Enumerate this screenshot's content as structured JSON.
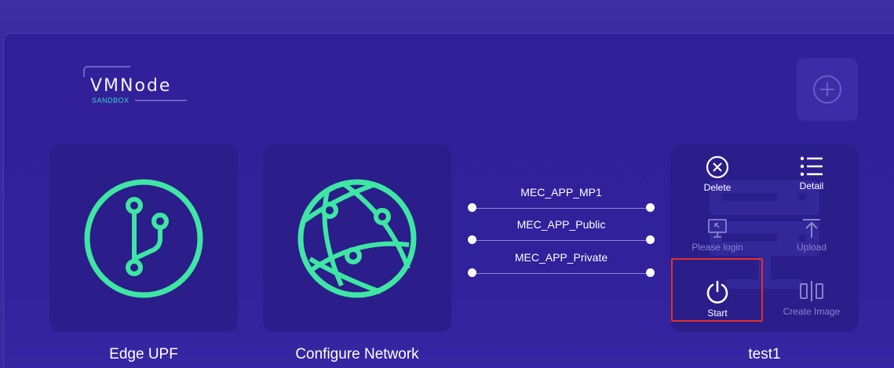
{
  "logo": {
    "title": "VMNode",
    "subtitle": "SANDBOX"
  },
  "add_button": {
    "icon": "plus-circle-icon"
  },
  "cards": [
    {
      "label": "Edge UPF",
      "icon": "git-branch-icon"
    },
    {
      "label": "Configure Network",
      "icon": "globe-network-icon"
    }
  ],
  "networks": [
    {
      "name": "MEC_APP_MP1"
    },
    {
      "name": "MEC_APP_Public"
    },
    {
      "name": "MEC_APP_Private"
    }
  ],
  "vm": {
    "name": "test1",
    "actions": {
      "delete": "Delete",
      "detail": "Detail",
      "login": "Please login",
      "upload": "Upload",
      "start": "Start",
      "create_image": "Create Image"
    }
  },
  "colors": {
    "accent": "#3ee6a4",
    "highlight": "#e0322c",
    "background": "#32209a"
  }
}
